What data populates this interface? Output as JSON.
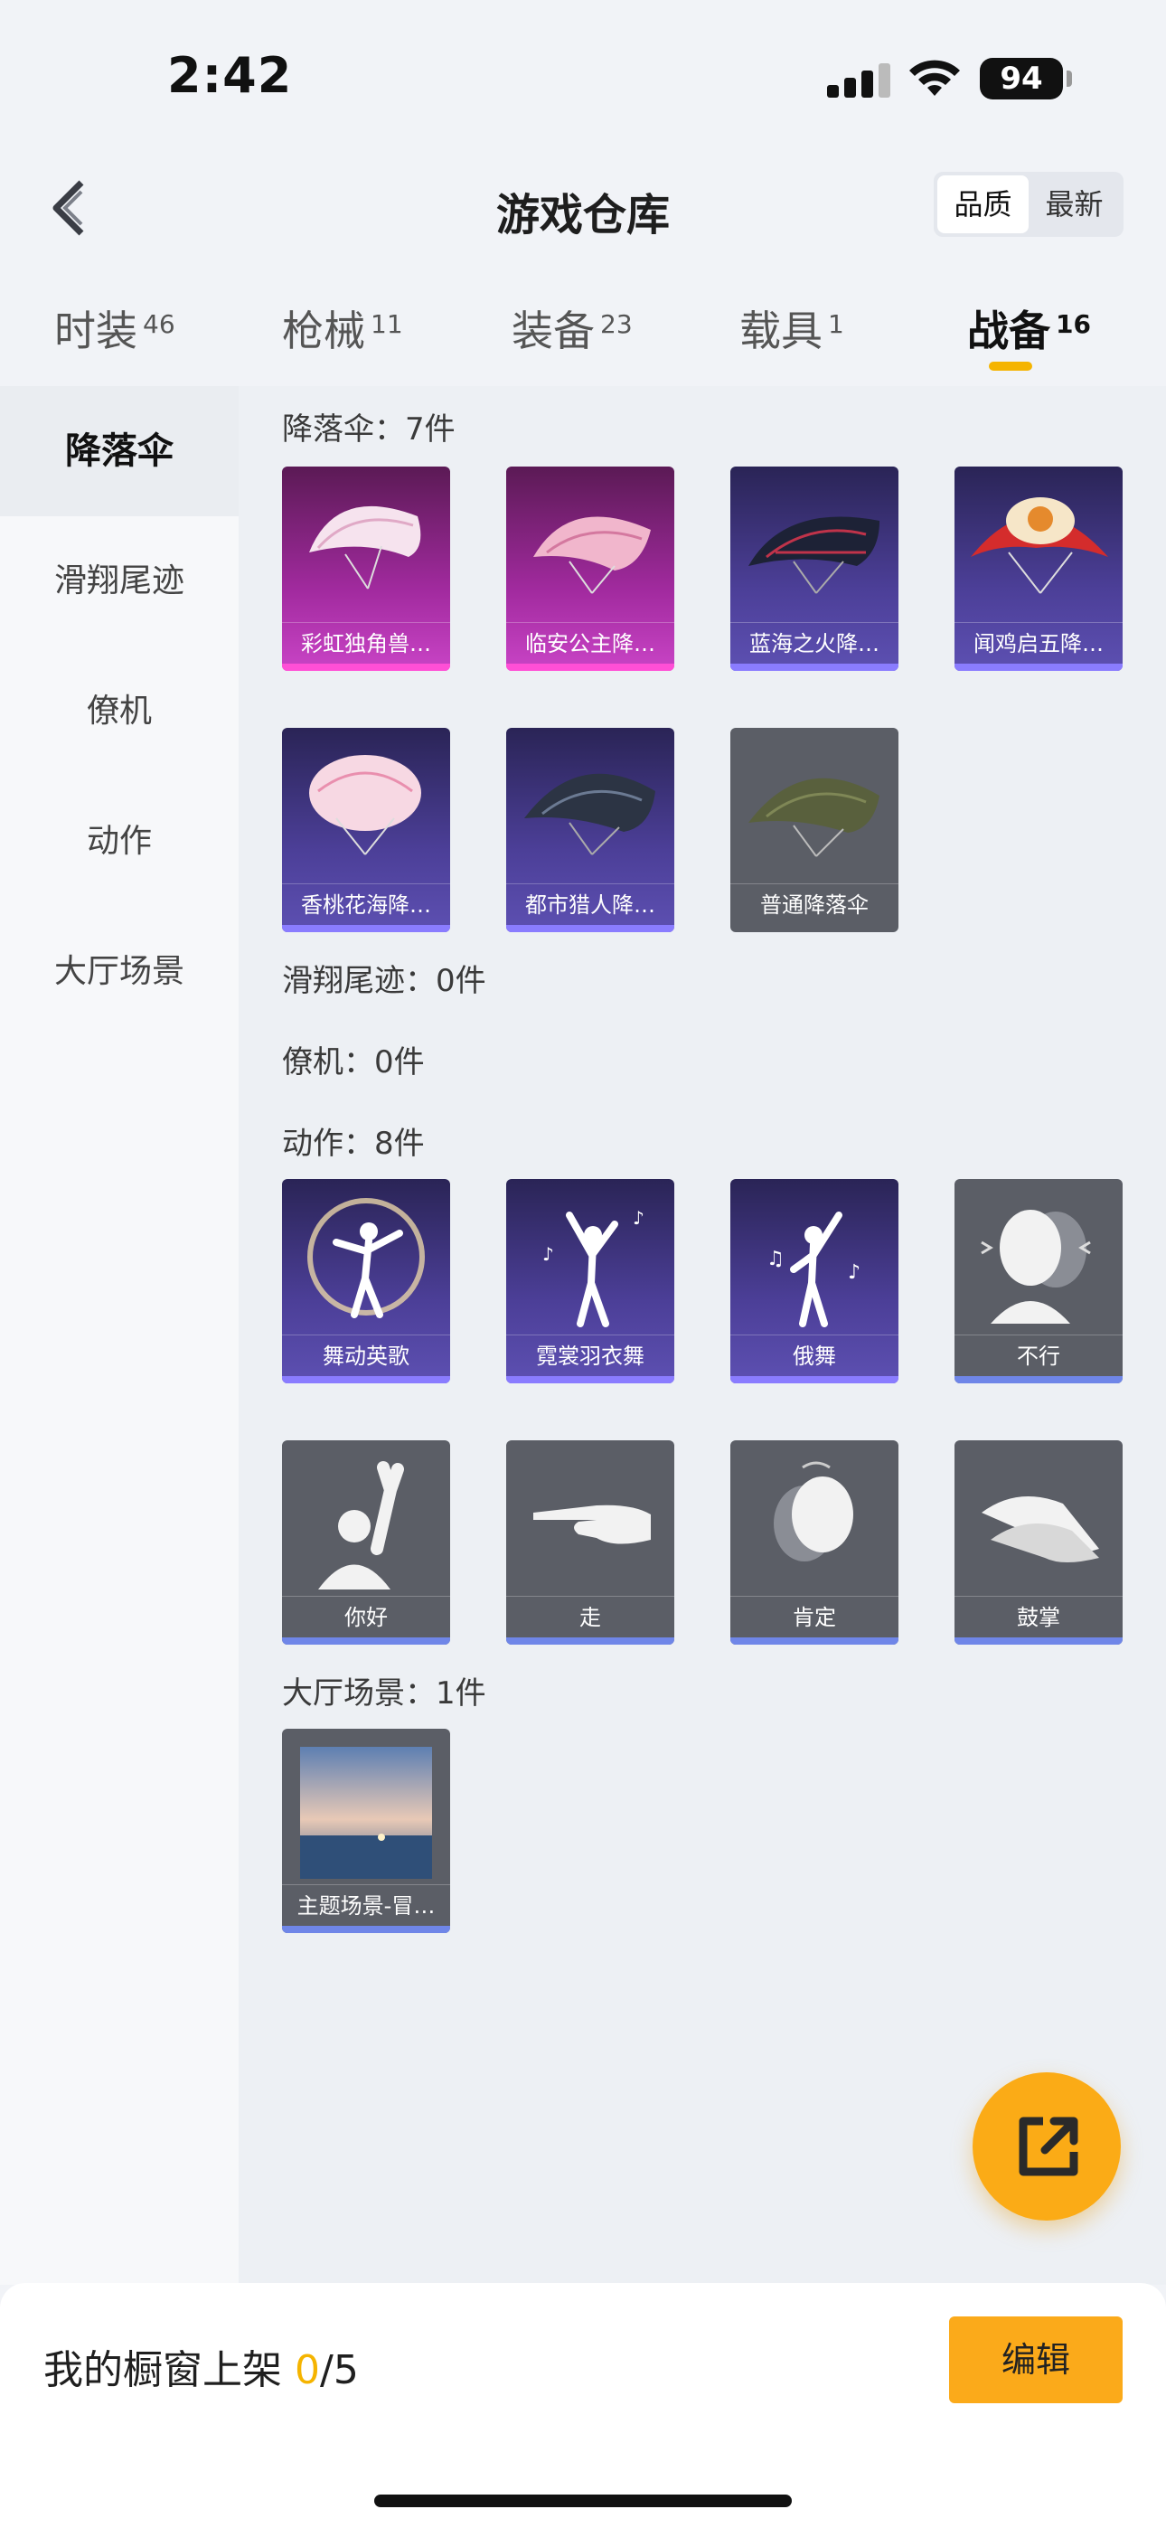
{
  "status": {
    "time": "2:42",
    "battery": "94"
  },
  "header": {
    "title": "游戏仓库",
    "sort_options": [
      "品质",
      "最新"
    ],
    "sort_active": "品质"
  },
  "tabs": [
    {
      "label": "时装",
      "count": "46"
    },
    {
      "label": "枪械",
      "count": "11"
    },
    {
      "label": "装备",
      "count": "23"
    },
    {
      "label": "载具",
      "count": "1"
    },
    {
      "label": "战备",
      "count": "16"
    }
  ],
  "active_tab": "战备",
  "sidebar": {
    "items": [
      "降落伞",
      "滑翔尾迹",
      "僚机",
      "动作",
      "大厅场景"
    ],
    "active": "降落伞"
  },
  "sections": {
    "parachute": {
      "title": "降落伞：7件",
      "items": [
        "彩虹独角兽…",
        "临安公主降…",
        "蓝海之火降…",
        "闻鸡启五降…",
        "香桃花海降…",
        "都市猎人降…",
        "普通降落伞"
      ]
    },
    "glide_trail": {
      "title": "滑翔尾迹：0件"
    },
    "wingman": {
      "title": "僚机：0件"
    },
    "emote": {
      "title": "动作：8件",
      "items": [
        "舞动英歌",
        "霓裳羽衣舞",
        "俄舞",
        "不行",
        "你好",
        "走",
        "肯定",
        "鼓掌"
      ]
    },
    "lobby": {
      "title": "大厅场景：1件",
      "items": [
        "主题场景-冒…"
      ]
    }
  },
  "bottom": {
    "showcase_label": "我的橱窗上架 ",
    "showcase_count": "0",
    "showcase_total": "/5",
    "edit_label": "编辑"
  },
  "colors": {
    "accent": "#fbaa1a",
    "legendary": "#c944c6",
    "epic": "#5d50b2",
    "common": "#5b5e66"
  }
}
